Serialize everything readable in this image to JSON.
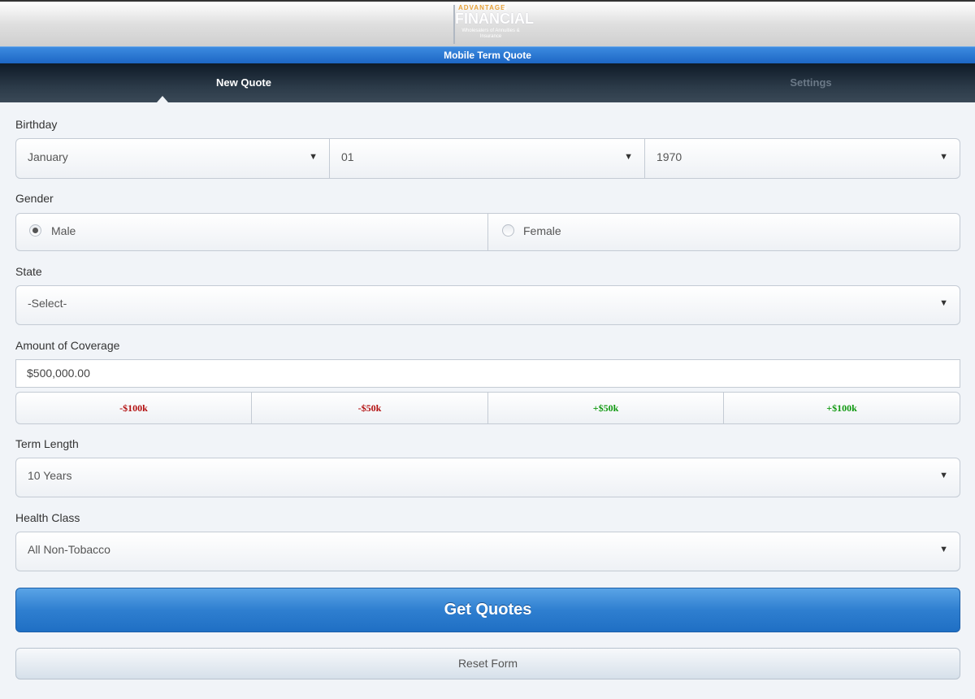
{
  "header": {
    "logo_tagline_top": "ADVANTAGE",
    "logo_name": "FINANCIAL",
    "logo_tagline": "Wholesalers of Annuities & Insurance",
    "subtitle": "Mobile Term Quote"
  },
  "nav": {
    "tabs": [
      {
        "label": "New Quote",
        "active": true
      },
      {
        "label": "Settings",
        "active": false
      }
    ]
  },
  "form": {
    "birthday": {
      "label": "Birthday",
      "month": "January",
      "day": "01",
      "year": "1970"
    },
    "gender": {
      "label": "Gender",
      "options": [
        "Male",
        "Female"
      ],
      "selected": "Male"
    },
    "state": {
      "label": "State",
      "value": "-Select-"
    },
    "coverage": {
      "label": "Amount of Coverage",
      "value": "$500,000.00",
      "adjusters": [
        "-$100k",
        "-$50k",
        "+$50k",
        "+$100k"
      ]
    },
    "term": {
      "label": "Term Length",
      "value": "10 Years"
    },
    "health": {
      "label": "Health Class",
      "value": "All Non-Tobacco"
    }
  },
  "actions": {
    "submit": "Get Quotes",
    "reset": "Reset Form"
  },
  "colors": {
    "accent_blue": "#2f7fd0",
    "negative": "#b31111",
    "positive": "#119911",
    "nav_bg": "#1a2836"
  }
}
